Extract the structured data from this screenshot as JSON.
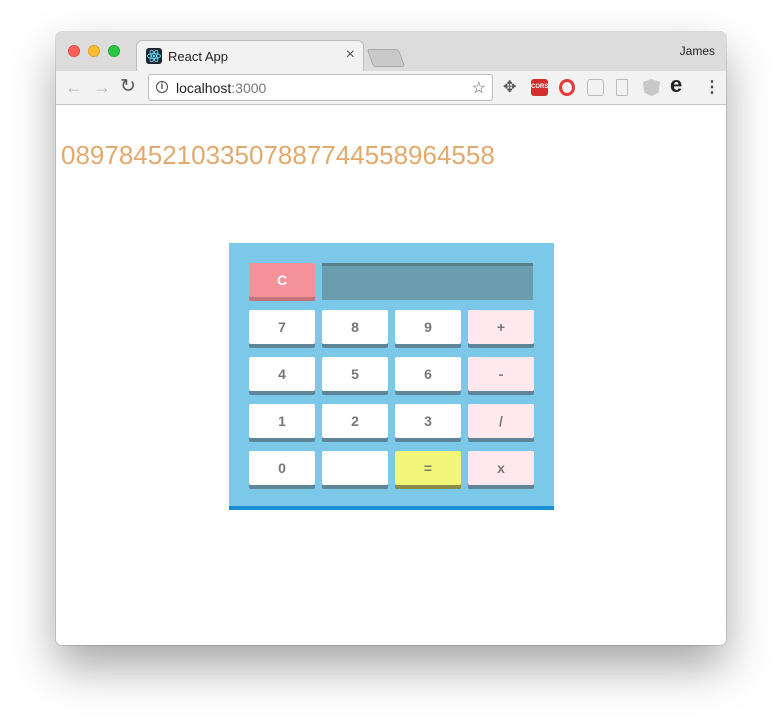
{
  "browser": {
    "tab_title": "React App",
    "tab_close": "×",
    "profile_name": "James",
    "url_host": "localhost",
    "url_port": ":3000",
    "icons": [
      "back-arrow-icon",
      "forward-arrow-icon",
      "reload-icon",
      "info-icon",
      "star-icon",
      "move-icon",
      "cors-extension-icon",
      "opera-icon",
      "react-devtools-icon",
      "page-icon",
      "angular-icon",
      "edge-icon",
      "menu-icon"
    ],
    "cors_label": "CORS"
  },
  "calculator": {
    "display_value": "08978452103350788774455896455​8",
    "clear_label": "C",
    "rows": [
      [
        "7",
        "8",
        "9",
        "+"
      ],
      [
        "4",
        "5",
        "6",
        "-"
      ],
      [
        "1",
        "2",
        "3",
        "/"
      ],
      [
        "0",
        "",
        "=",
        "x"
      ]
    ],
    "colors": {
      "body": "#7cc8e8",
      "display": "#6a9dad",
      "display_text": "#e3a96c",
      "clear_key": "#f4919a",
      "operator_key": "#ffe9ee",
      "equals_key": "#f2f77a",
      "bottom_border": "#1a8fd6"
    }
  }
}
